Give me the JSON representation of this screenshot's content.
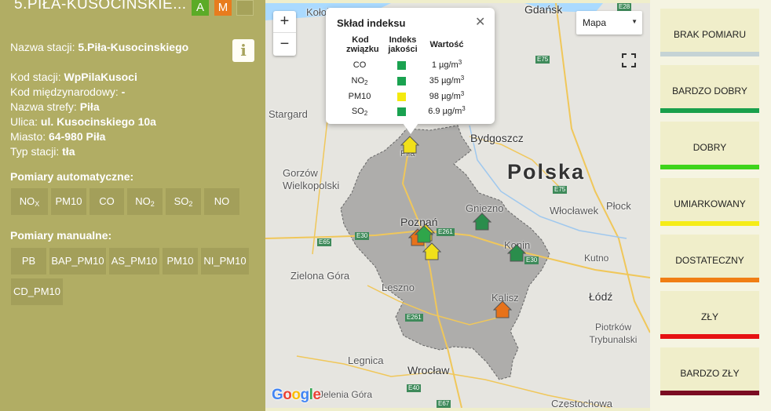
{
  "station": {
    "title": "5.PIŁA-KUSOCINSKIE...",
    "btn_auto": "A",
    "btn_manual": "M",
    "name_label": "Nazwa stacji:",
    "name_value": "5.Piła-Kusocinskiego",
    "code_label": "Kod stacji:",
    "code_value": "WpPilaKusoci",
    "intl_label": "Kod międzynarodowy:",
    "intl_value": "-",
    "zone_label": "Nazwa strefy:",
    "zone_value": "Piła",
    "street_label": "Ulica:",
    "street_value": "ul. Kusocinskiego 10a",
    "city_label": "Miasto:",
    "city_value": "64-980 Piła",
    "type_label": "Typ stacji:",
    "type_value": "tła",
    "auto_title": "Pomiary automatyczne:",
    "auto_params": [
      {
        "base": "NO",
        "sub": "X"
      },
      {
        "base": "PM10",
        "sub": ""
      },
      {
        "base": "CO",
        "sub": ""
      },
      {
        "base": "NO",
        "sub": "2"
      },
      {
        "base": "SO",
        "sub": "2"
      },
      {
        "base": "NO",
        "sub": ""
      }
    ],
    "manual_title": "Pomiary manualne:",
    "manual_params": [
      "PB",
      "BAP_PM10",
      "AS_PM10",
      "PM10",
      "NI_PM10",
      "CD_PM10"
    ],
    "info_icon": "info-icon"
  },
  "map": {
    "type_select": "Mapa",
    "zoom_in": "+",
    "zoom_out": "−",
    "country": "Polska",
    "cities": [
      "Kołob",
      "Gdańsk",
      "Stargard",
      "Bydgoszcz",
      "Gorzów Wielkopolski",
      "Poznań",
      "Gniezno",
      "Włocławek",
      "Płock",
      "Konin",
      "Kutno",
      "Zielona Góra",
      "Leszno",
      "Kalisz",
      "Łódź",
      "Piotrków Trybunalski",
      "Legnica",
      "Wrocław",
      "Jelenia Góra",
      "Częstochowa",
      "Piła"
    ],
    "roads": [
      "E28",
      "E75",
      "E75",
      "E65",
      "E30",
      "E261",
      "E30",
      "E261",
      "E40",
      "E67"
    ],
    "google": "Google",
    "popup": {
      "title": "Skład indeksu",
      "h_code": "Kod związku",
      "h_index": "Indeks jakości",
      "h_value": "Wartość",
      "rows": [
        {
          "code": "CO",
          "sub": "",
          "color": "#1aa250",
          "value": "1 µg/m",
          "unit_sup": "3"
        },
        {
          "code": "NO",
          "sub": "2",
          "color": "#1aa250",
          "value": "35 µg/m",
          "unit_sup": "3"
        },
        {
          "code": "PM10",
          "sub": "",
          "color": "#f4ea0e",
          "value": "98 µg/m",
          "unit_sup": "3"
        },
        {
          "code": "SO",
          "sub": "2",
          "color": "#1aa250",
          "value": "6.9 µg/m",
          "unit_sup": "3"
        }
      ]
    },
    "markers": [
      {
        "label": "Piła",
        "color": "#f1e01a"
      },
      {
        "label": "Poznań-1",
        "color": "#e7721a"
      },
      {
        "label": "Poznań-2",
        "color": "#f1e01a"
      },
      {
        "label": "Poznań-3",
        "color": "#2fa64a"
      },
      {
        "label": "Poznań-4",
        "color": "#f1e01a"
      },
      {
        "label": "Gniezno",
        "color": "#2a8d4c"
      },
      {
        "label": "Konin",
        "color": "#2a8d4c"
      },
      {
        "label": "Kalisz",
        "color": "#e7721a"
      }
    ]
  },
  "legend": [
    {
      "label": "BRAK POMIARU",
      "color": "#c5d3d5"
    },
    {
      "label": "BARDZO DOBRY",
      "color": "#1aa04c"
    },
    {
      "label": "DOBRY",
      "color": "#3ed41a"
    },
    {
      "label": "UMIARKOWANY",
      "color": "#f5ec18"
    },
    {
      "label": "DOSTATECZNY",
      "color": "#f07e14"
    },
    {
      "label": "ZŁY",
      "color": "#e61111"
    },
    {
      "label": "BARDZO ZŁY",
      "color": "#7a0c22"
    }
  ]
}
